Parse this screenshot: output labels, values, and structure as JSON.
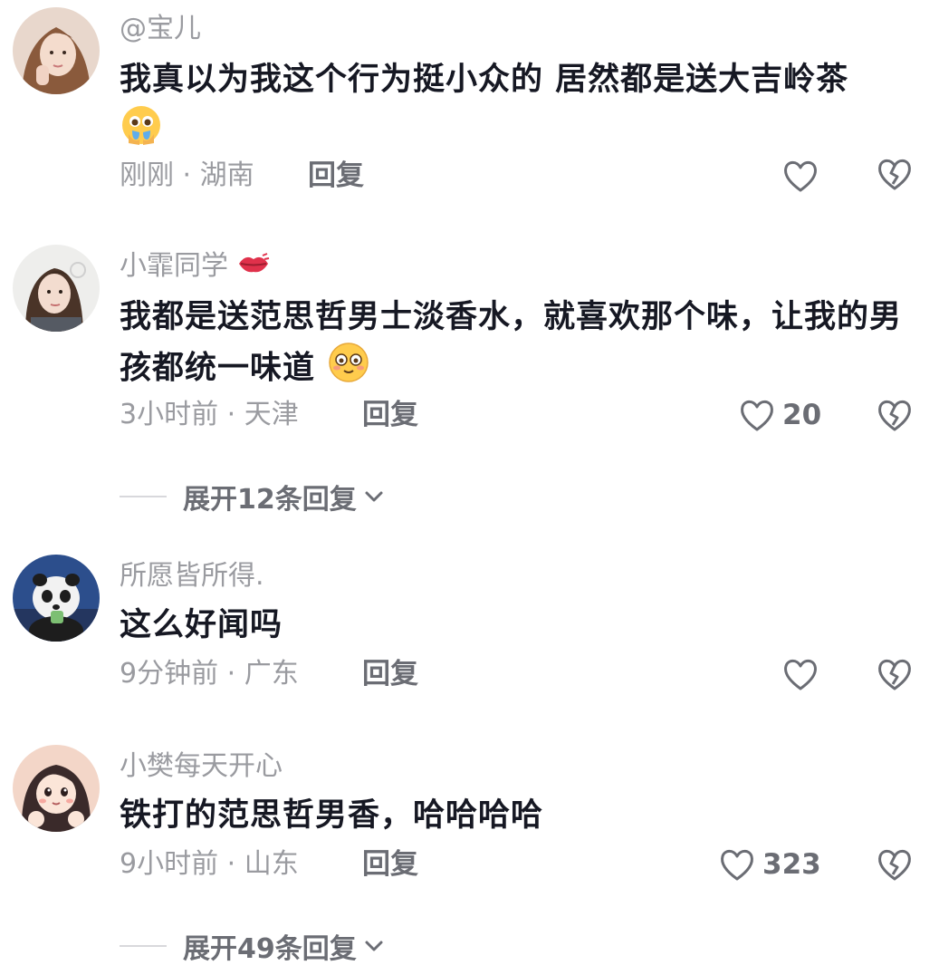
{
  "comments": [
    {
      "username": "@宝儿",
      "text": "我真以为我这个行为挺小众的 居然都是送大吉岭茶",
      "emoji": "crying-pleading-face",
      "time_location": "刚刚 · 湖南",
      "reply_label": "回复",
      "like_count": ""
    },
    {
      "username": "小霏同学",
      "name_badge": "lips-kiss-icon",
      "text": "我都是送范思哲男士淡香水，就喜欢那个味，让我的男孩都统一味道",
      "emoji": "smiling-face",
      "time_location": "3小时前 · 天津",
      "reply_label": "回复",
      "like_count": "20",
      "expand_label": "展开12条回复"
    },
    {
      "username": "所愿皆所得.",
      "text": "这么好闻吗",
      "time_location": "9分钟前 · 广东",
      "reply_label": "回复",
      "like_count": ""
    },
    {
      "username": "小樊每天开心",
      "text": "铁打的范思哲男香，哈哈哈哈",
      "time_location": "9小时前 · 山东",
      "reply_label": "回复",
      "like_count": "323",
      "expand_label": "展开49条回复"
    }
  ],
  "colors": {
    "text": "#161823",
    "secondary": "#9a9ba0",
    "action": "#6b6d74",
    "background": "#ffffff"
  }
}
